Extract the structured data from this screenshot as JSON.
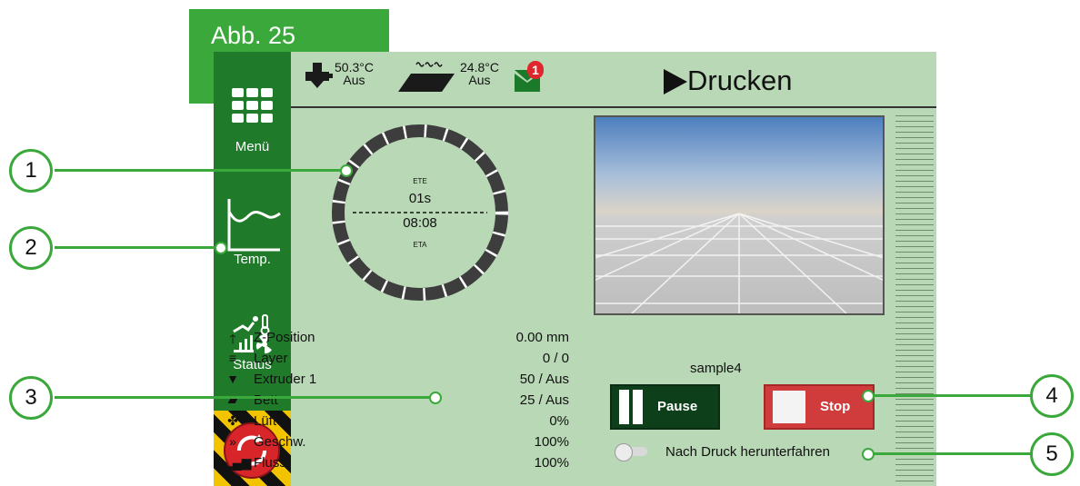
{
  "figure_label": "Abb. 25",
  "screen": {
    "title": "Drucken",
    "extruder_temp": {
      "value": "50.3°C",
      "state": "Aus"
    },
    "bed_temp": {
      "value": "24.8°C",
      "state": "Aus"
    },
    "message_count": "1",
    "sidebar": {
      "menu_label": "Menü",
      "temp_label": "Temp.",
      "status_label": "Status"
    },
    "gauge": {
      "ete_label": "ETE",
      "ete_value": "01s",
      "eta_value": "08:08",
      "eta_label": "ETA"
    },
    "stats": [
      {
        "icon": "arrow-up-icon",
        "label": "Z-Position",
        "value": "0.00 mm"
      },
      {
        "icon": "layers-icon",
        "label": "Layer",
        "value": "0 / 0"
      },
      {
        "icon": "extruder-icon",
        "label": "Extruder 1",
        "value": "50 / Aus"
      },
      {
        "icon": "bed-icon",
        "label": "Bett",
        "value": "25 / Aus"
      },
      {
        "icon": "fan-icon",
        "label": "Lüfter",
        "value": "0%"
      },
      {
        "icon": "speed-icon",
        "label": "Geschw.",
        "value": "100%"
      },
      {
        "icon": "flow-icon",
        "label": "Fluss",
        "value": "100%"
      }
    ],
    "job_name": "sample4",
    "pause_label": "Pause",
    "stop_label": "Stop",
    "shutdown_label": "Nach Druck herunterfahren"
  },
  "callouts": [
    "1",
    "2",
    "3",
    "4",
    "5"
  ],
  "colors": {
    "accent_green": "#3aa83a",
    "sidebar_green": "#1f7a2a",
    "screen_bg": "#b9d9b6",
    "pause_bg": "#0d3f1a",
    "stop_bg": "#d03b3b",
    "badge_red": "#e0262b"
  }
}
